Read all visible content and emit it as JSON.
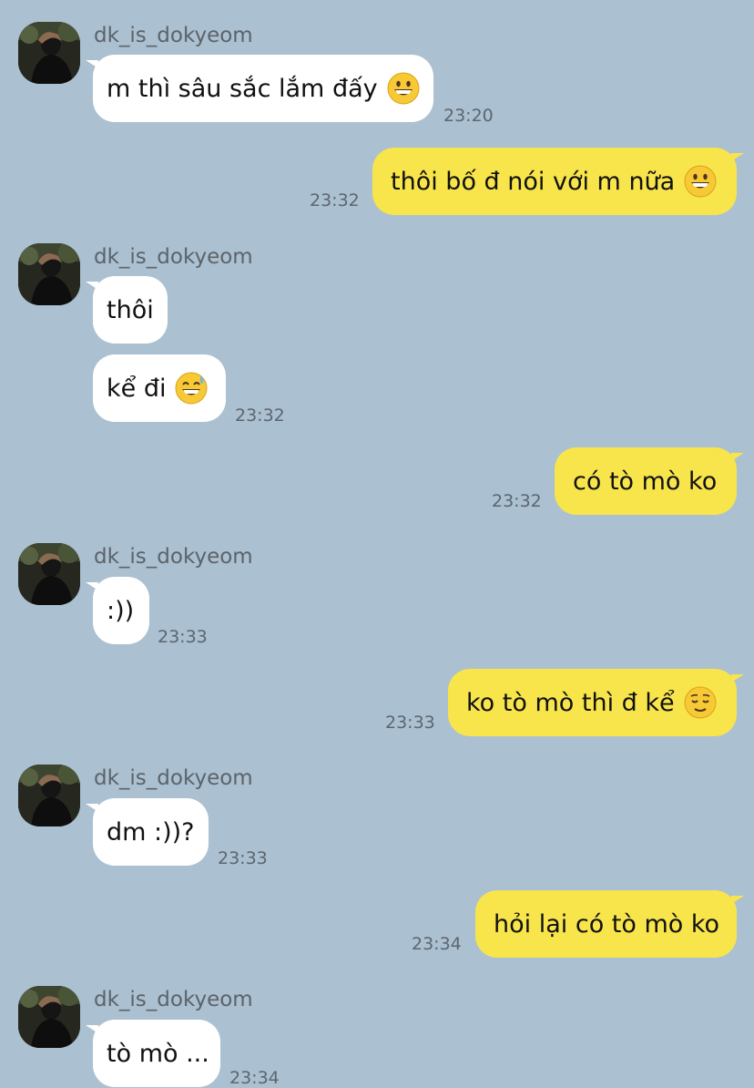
{
  "chat": {
    "messages": [
      {
        "sender": "dk_is_dokyeom",
        "text": "m thì sâu sắc lắm đấy",
        "emoji": "grinning-face",
        "time": "23:20"
      },
      {
        "text": "thôi bố đ nói với m nữa",
        "emoji": "grinning-face",
        "time": "23:32"
      },
      {
        "sender": "dk_is_dokyeom",
        "text": "thôi"
      },
      {
        "text": "kể đi",
        "emoji": "grinning-face-with-sweat",
        "time": "23:32"
      },
      {
        "text": "có tò mò ko",
        "time": "23:32"
      },
      {
        "sender": "dk_is_dokyeom",
        "text": ":))",
        "time": "23:33"
      },
      {
        "text": "ko tò mò thì đ kể",
        "emoji": "relieved-face",
        "time": "23:33"
      },
      {
        "sender": "dk_is_dokyeom",
        "text": "dm :))?",
        "time": "23:33"
      },
      {
        "text": "hỏi lại có tò mò ko",
        "time": "23:34"
      },
      {
        "sender": "dk_is_dokyeom",
        "text": "tò mò ...",
        "time": "23:34"
      }
    ]
  },
  "colors": {
    "background": "#abc0d0",
    "incoming_bubble": "#ffffff",
    "outgoing_bubble": "#f8e54b"
  }
}
